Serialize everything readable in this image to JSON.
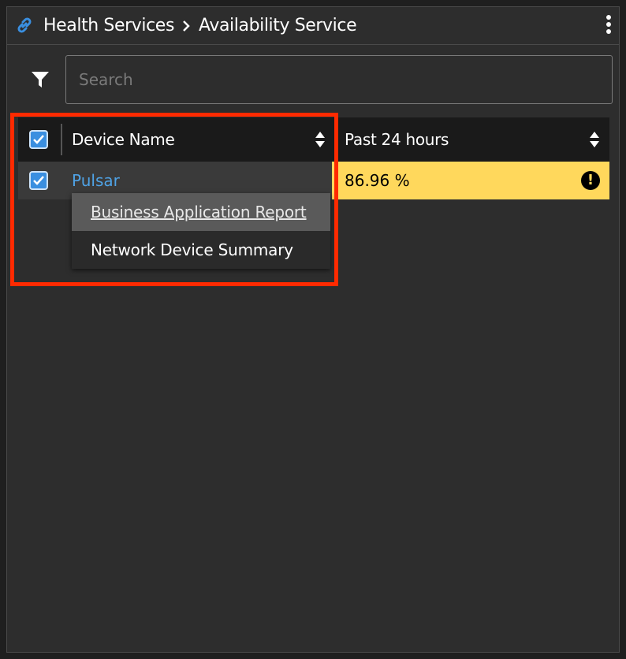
{
  "header": {
    "breadcrumb": [
      "Health Services",
      "Availability Service"
    ],
    "icon": "link-icon",
    "menu_icon": "kebab-icon"
  },
  "filter": {
    "icon": "filter-icon",
    "search_placeholder": "Search",
    "search_value": ""
  },
  "table": {
    "columns": [
      {
        "label": "Device Name",
        "sortable": true
      },
      {
        "label": "Past 24 hours",
        "sortable": true
      }
    ],
    "select_all_checked": true,
    "rows": [
      {
        "checked": true,
        "device": "Pulsar",
        "availability": "86.96 %",
        "status": "warning",
        "status_color": "#ffd85c"
      }
    ]
  },
  "context_menu": {
    "items": [
      "Business Application Report",
      "Network Device Summary"
    ],
    "active_index": 0
  },
  "colors": {
    "accent": "#3a8fe0",
    "link": "#4fa3e6",
    "warning": "#ffd85c",
    "highlight": "#ff2a00"
  }
}
